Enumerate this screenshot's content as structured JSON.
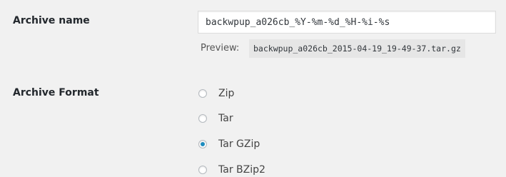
{
  "archive_name": {
    "label": "Archive name",
    "value": "backwpup_a026cb_%Y-%m-%d_%H-%i-%s",
    "preview_label": "Preview:",
    "preview_value": "backwpup_a026cb_2015-04-19_19-49-37.tar.gz"
  },
  "archive_format": {
    "label": "Archive Format",
    "options": [
      {
        "label": "Zip",
        "checked": false
      },
      {
        "label": "Tar",
        "checked": false
      },
      {
        "label": "Tar GZip",
        "checked": true
      },
      {
        "label": "Tar BZip2",
        "checked": false
      }
    ]
  }
}
